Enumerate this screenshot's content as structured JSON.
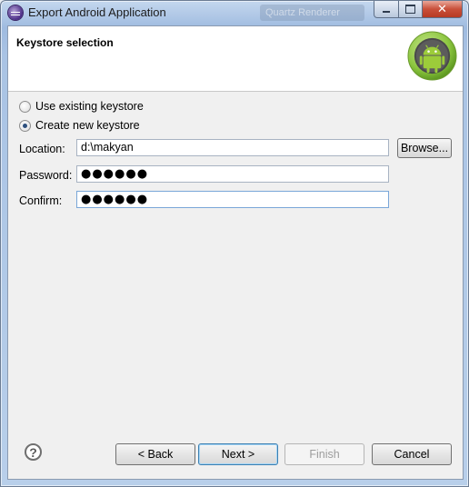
{
  "window": {
    "title": "Export Android Application",
    "background_tab": "Quartz Renderer"
  },
  "header": {
    "title": "Keystore selection"
  },
  "keystore_options": [
    {
      "label": "Use existing keystore",
      "checked": false
    },
    {
      "label": "Create new keystore",
      "checked": true
    }
  ],
  "fields": {
    "location": {
      "label": "Location:",
      "value": "d:\\makyan"
    },
    "password": {
      "label": "Password:",
      "value": "●●●●●●"
    },
    "confirm": {
      "label": "Confirm:",
      "value": "●●●●●●"
    }
  },
  "browse_label": "Browse...",
  "buttons": {
    "back": "< Back",
    "next": "Next >",
    "finish": "Finish",
    "cancel": "Cancel"
  },
  "help_glyph": "?",
  "colors": {
    "android_green": "#8cc63f",
    "header_bg": "#ffffff",
    "dialog_bg": "#f0f0f0"
  }
}
